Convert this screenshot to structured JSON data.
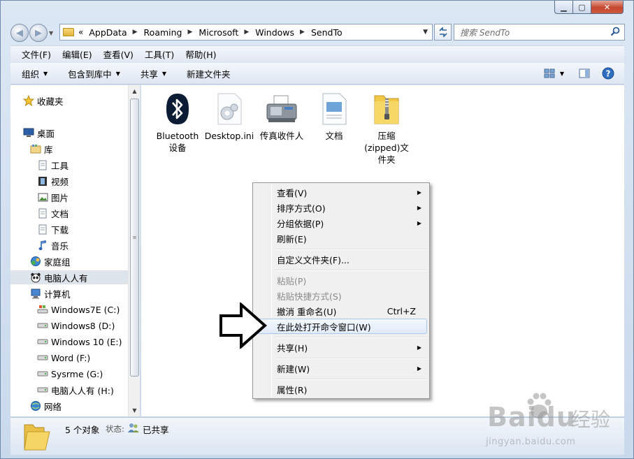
{
  "address": {
    "overflow": "«",
    "crumbs": [
      "AppData",
      "Roaming",
      "Microsoft",
      "Windows",
      "SendTo"
    ]
  },
  "search": {
    "placeholder": "搜索 SendTo"
  },
  "menubar": [
    "文件(F)",
    "编辑(E)",
    "查看(V)",
    "工具(T)",
    "帮助(H)"
  ],
  "commands": {
    "organize": "组织",
    "include": "包含到库中",
    "share": "共享",
    "new_folder": "新建文件夹"
  },
  "navtree": [
    {
      "label": "收藏夹",
      "icon": "star-icon"
    },
    {
      "label": "桌面",
      "icon": "desktop-icon"
    },
    {
      "label": "库",
      "icon": "library-icon"
    },
    {
      "label": "工具",
      "icon": "document-icon"
    },
    {
      "label": "视频",
      "icon": "video-icon"
    },
    {
      "label": "图片",
      "icon": "picture-icon"
    },
    {
      "label": "文档",
      "icon": "document-icon"
    },
    {
      "label": "下载",
      "icon": "document-icon"
    },
    {
      "label": "音乐",
      "icon": "music-icon"
    },
    {
      "label": "家庭组",
      "icon": "homegroup-icon"
    },
    {
      "label": "电脑人人有",
      "icon": "panda-icon"
    },
    {
      "label": "计算机",
      "icon": "computer-icon"
    },
    {
      "label": "Windows7E (C:)",
      "icon": "system-drive-icon"
    },
    {
      "label": "Windows8 (D:)",
      "icon": "drive-icon"
    },
    {
      "label": "Windows 10 (E:)",
      "icon": "drive-icon"
    },
    {
      "label": "Word (F:)",
      "icon": "drive-icon"
    },
    {
      "label": "Sysrme (G:)",
      "icon": "drive-icon"
    },
    {
      "label": "电脑人人有 (H:)",
      "icon": "drive-icon"
    },
    {
      "label": "网络",
      "icon": "network-icon"
    }
  ],
  "files": [
    {
      "label": "Bluetooth 设备",
      "icon": "bluetooth-icon"
    },
    {
      "label": "Desktop.ini",
      "icon": "settings-file-icon"
    },
    {
      "label": "传真收件人",
      "icon": "fax-icon"
    },
    {
      "label": "文档",
      "icon": "document-icon"
    },
    {
      "label": "压缩(zipped)文件夹",
      "icon": "zip-folder-icon"
    }
  ],
  "context_menu": {
    "view": "查看(V)",
    "sort": "排序方式(O)",
    "group": "分组依据(P)",
    "refresh": "刷新(E)",
    "customize": "自定义文件夹(F)...",
    "paste": "粘贴(P)",
    "paste_shortcut": "粘贴快捷方式(S)",
    "undo": "撤消 重命名(U)",
    "undo_shortcut": "Ctrl+Z",
    "open_cmd": "在此处打开命令窗口(W)",
    "share": "共享(H)",
    "new": "新建(W)",
    "properties": "属性(R)"
  },
  "status": {
    "count": "5 个对象",
    "state_label": "状态:",
    "state_value": "已共享"
  },
  "watermark": {
    "logo": "Baidu",
    "suffix": "经验",
    "url": "jingyan.baidu.com"
  },
  "colors": {
    "selection": "#dde4ec",
    "highlight_border": "#a9c8ec",
    "close_button": "#c4472e"
  }
}
